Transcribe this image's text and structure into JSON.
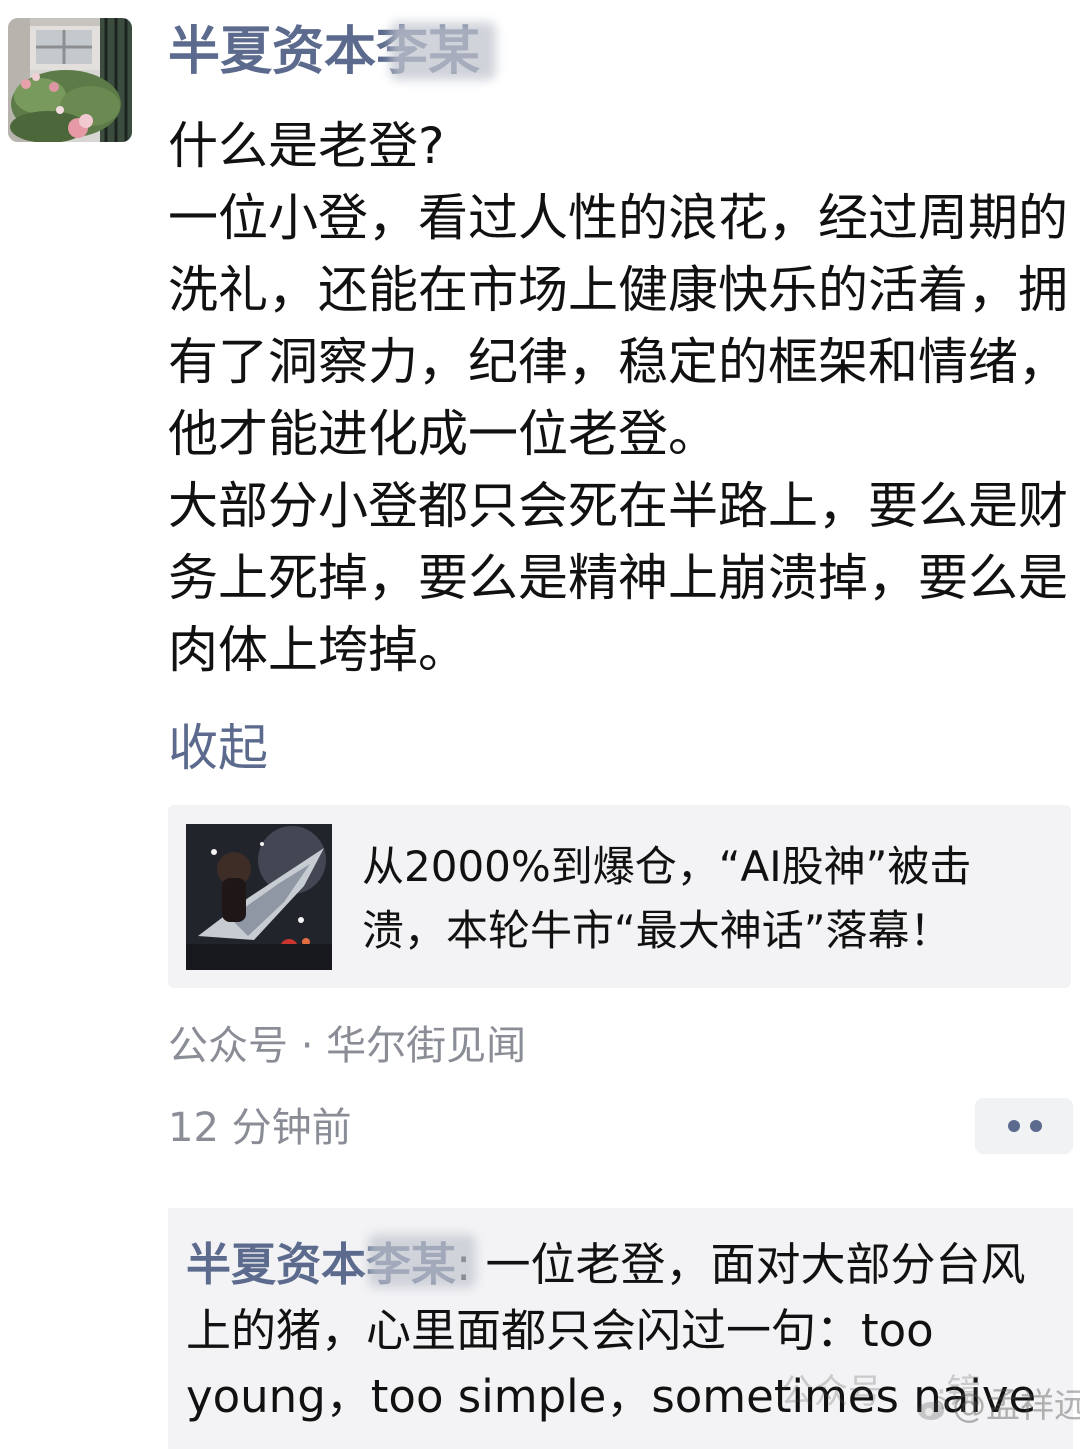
{
  "post": {
    "author_name": "半夏资本李某",
    "body": {
      "line_1": "什么是老登?",
      "line_2": "一位小登，看过人性的浪花，经过周期的洗礼，还能在市场上健康快乐的活着，拥有了洞察力，纪律，稳定的框架和情绪，他才能进化成一位老登。",
      "line_3": "大部分小登都只会死在半路上，要么是财务上死掉，要么是精神上崩溃掉，要么是肉体上垮掉。"
    },
    "collapse_label": "收起"
  },
  "shared_article": {
    "title": "从2000%到爆仓，“AI股神”被击溃，本轮牛市“最大神话”落幕！",
    "source": "公众号 · 华尔街见闻"
  },
  "meta": {
    "timestamp": "12 分钟前"
  },
  "comment": {
    "author": "半夏资本李某",
    "separator": ":",
    "text": "一位老登，面对大部分台风上的猪，心里面都只会闪过一句：too young，too simple，sometimes naive"
  },
  "watermark": {
    "left_text": "公众号",
    "right_text": "·镜",
    "handle": "@孟祥远"
  },
  "icons": {
    "avatar": "garden-avatar-icon",
    "article_thumbnail": "article-thumbnail-icon",
    "more": "more-options-icon",
    "weibo": "weibo-icon"
  },
  "colors": {
    "name_link": "#5b6a8d",
    "meta_text": "#8a8d96",
    "card_bg": "#f3f3f5"
  }
}
